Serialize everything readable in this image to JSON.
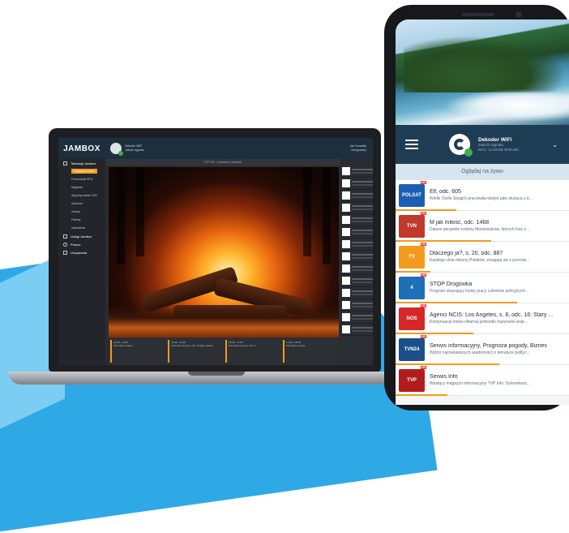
{
  "laptop_app": {
    "logo": "JAMBOX",
    "device_name": "Dekoder WiFi",
    "device_status": "Jakość sygnału",
    "user_name": "Jan Kowalski",
    "user_status": "Zalogowany",
    "player_header": "TVP HD - Kominek w telewizji",
    "sidebar": [
      {
        "label": "Telewizja Jambox",
        "type": "section",
        "icon": "tv-icon"
      },
      {
        "label": "Oglądaj na żywo",
        "type": "sub",
        "active": true
      },
      {
        "label": "Przewodnik EPG",
        "type": "sub"
      },
      {
        "label": "Nagrania",
        "type": "sub"
      },
      {
        "label": "Wypożyczalnia VOD",
        "type": "sub"
      },
      {
        "label": "Ulubione",
        "type": "sub"
      },
      {
        "label": "Szukaj",
        "type": "sub"
      },
      {
        "label": "Pakiety",
        "type": "sub"
      },
      {
        "label": "Ustawienia",
        "type": "sub"
      },
      {
        "label": "Usługi Jambox",
        "type": "section",
        "icon": "services-icon"
      },
      {
        "label": "Pomoc",
        "type": "section",
        "icon": "help-icon"
      },
      {
        "label": "Urządzenia",
        "type": "section",
        "icon": "devices-icon"
      }
    ],
    "epg_strip": [
      {
        "time": "12:30 - 14:00",
        "title": "Kominek na zywo"
      },
      {
        "time": "14:00 - 15:30",
        "title": "Kominek na zywo, odc. 2 Ogień gasnie"
      },
      {
        "time": "15:30 - 17:00",
        "title": "Kominek na zywo, odc. 3"
      },
      {
        "time": "17:00 - 18:30",
        "title": "Kominek na zywo"
      }
    ],
    "channel_count": 14
  },
  "phone_app": {
    "device_title": "Dekoder WiFi",
    "device_line1": "Jakość sygnału",
    "device_line2": "MAC: 12:34:56:78:9A:BC",
    "now_tab": "Oglądaj na żywo",
    "programs": [
      {
        "logo": "POLSAT",
        "logo_color": "#1a5fb4",
        "title": "Elf, odc. 605",
        "desc": "Wielki (Selin Sezgin) pracowała kiedyś jako służąca u b...",
        "progress": 0.35
      },
      {
        "logo": "TVN",
        "logo_color": "#c0392b",
        "title": "M jak miłość, odc. 1468",
        "desc": "Dalsze perypetie rodziny Mostowiaków, których losy z...",
        "progress": 0.55
      },
      {
        "logo": "TV",
        "logo_color": "#f29b1d",
        "title": "Dlaczego ja?, s. 20, odc. 887",
        "desc": "Każdego dnia miliony Polaków, zmagają się z przeciw...",
        "progress": 0.2
      },
      {
        "logo": "4",
        "logo_color": "#1d6fb8",
        "title": "STOP Drogówka",
        "desc": "Program ukazujący kulisy pracy członków policyjnych...",
        "progress": 0.7
      },
      {
        "logo": "NOS",
        "logo_color": "#d62828",
        "title": "Agenci NCIS: Los Angeles, s. 8, odc. 16: Stary ...",
        "desc": "Kontynuacja losów elitarnej jednostki marynarki woje...",
        "progress": 0.45
      },
      {
        "logo": "TVN24",
        "logo_color": "#1b4f8a",
        "title": "Serwis informacyjny, Prognoza pogody, Biznes",
        "desc": "Wybór najciekawszych wiadomości o tematyce polityc...",
        "progress": 0.6
      },
      {
        "logo": "TVP",
        "logo_color": "#b01c1c",
        "title": "Serwis Info",
        "desc": "Wiodący magazyn informacyjny TVP Info. Dziennikarz...",
        "progress": 0.3
      }
    ]
  }
}
